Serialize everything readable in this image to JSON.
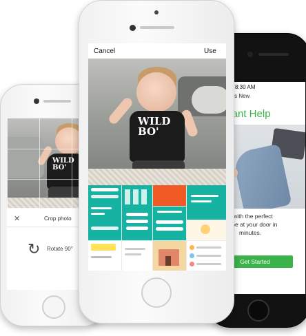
{
  "left_phone": {
    "screen_title": "Crop photo",
    "rotate_label": "Rotate 90°",
    "close_icon": "close-icon",
    "rotate_icon": "rotate-icon"
  },
  "center_phone": {
    "cancel_label": "Cancel",
    "use_label": "Use",
    "shirt_text_line1": "WILD",
    "shirt_text_line2": "BO'"
  },
  "right_phone": {
    "time": "8:30 AM",
    "back_label": "What's New",
    "heading": "stant Help",
    "body_line1": "h you with the perfect",
    "body_line2": "r can be at your door in",
    "body_line3": "minutes.",
    "cta_label": "Get Started"
  },
  "colors": {
    "teal": "#16b3a3",
    "orange": "#f15a24",
    "green": "#3bb34a",
    "yellow": "#ffe15a"
  }
}
